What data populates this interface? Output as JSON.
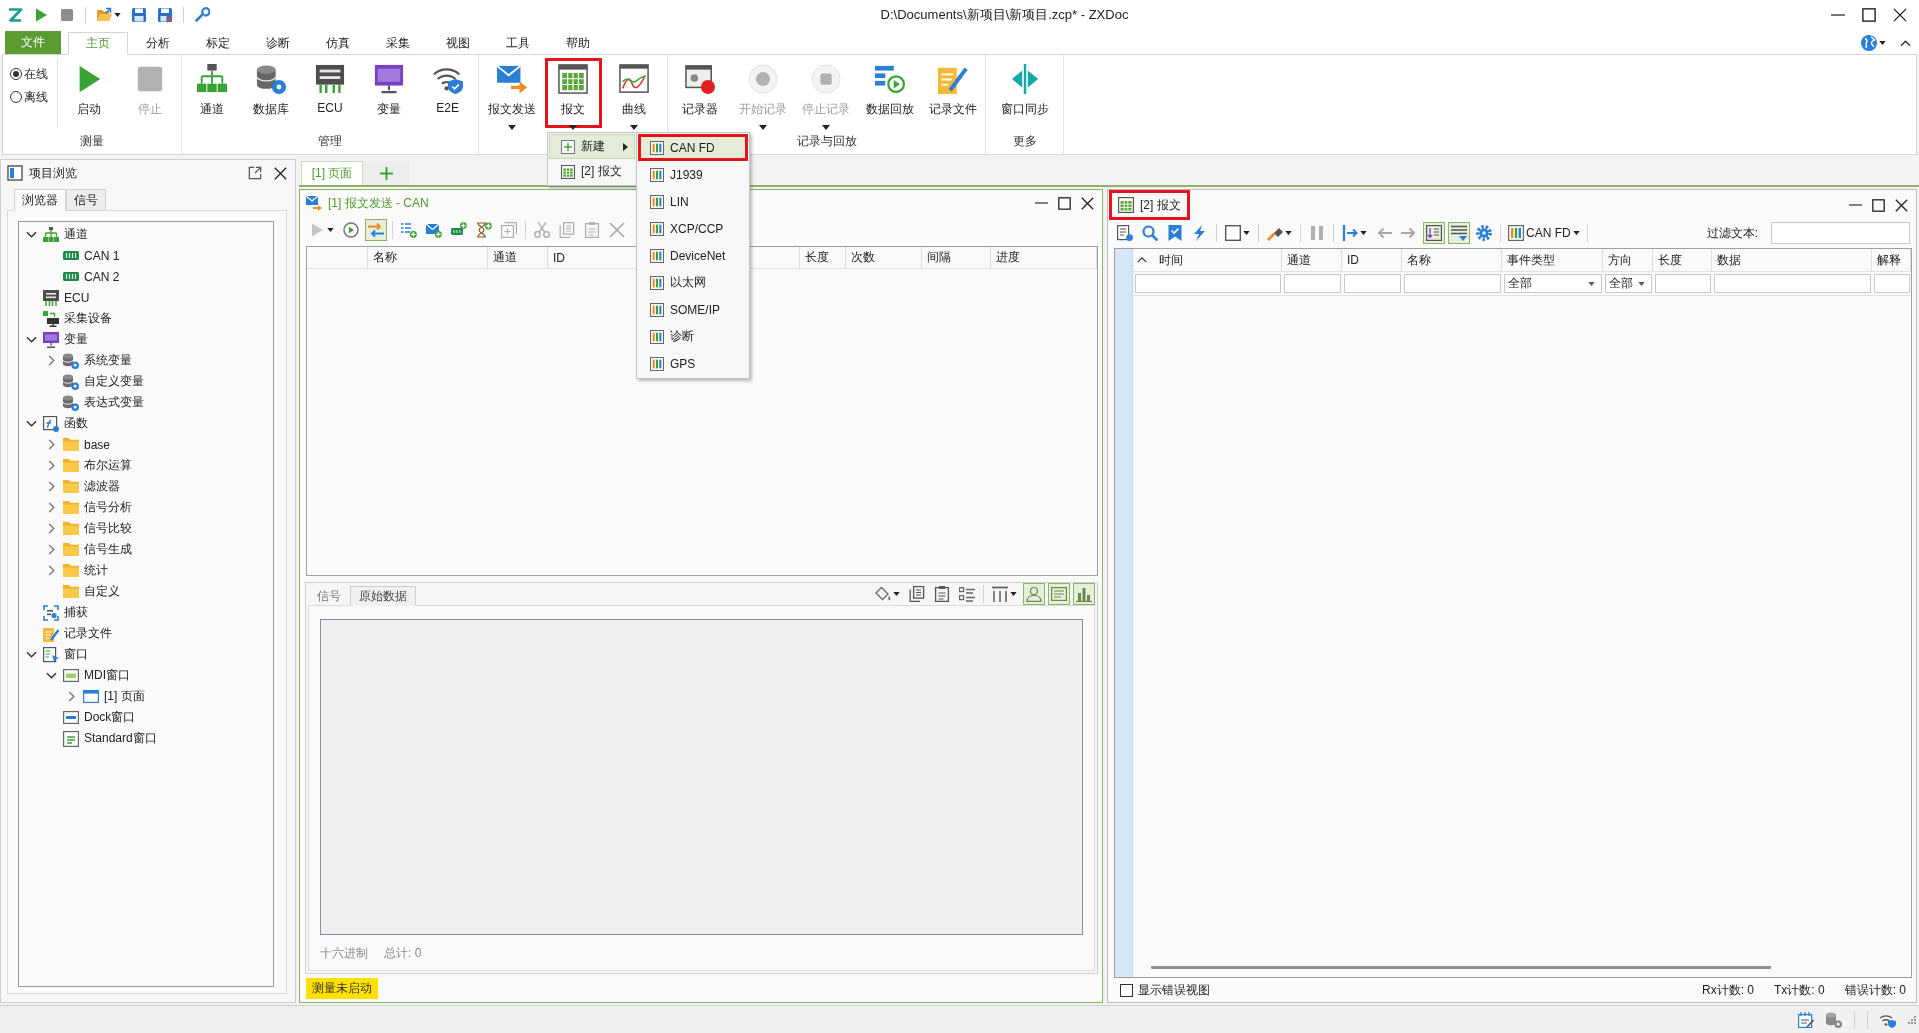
{
  "window": {
    "title": "D:\\Documents\\新项目\\新项目.zcp* - ZXDoc"
  },
  "ribbon": {
    "file_tab": "文件",
    "tabs": [
      {
        "label": "主页",
        "selected": true
      },
      {
        "label": "分析",
        "selected": false
      },
      {
        "label": "标定",
        "selected": false
      },
      {
        "label": "诊断",
        "selected": false
      },
      {
        "label": "仿真",
        "selected": false
      },
      {
        "label": "采集",
        "selected": false
      },
      {
        "label": "视图",
        "selected": false
      },
      {
        "label": "工具",
        "selected": false
      },
      {
        "label": "帮助",
        "selected": false
      }
    ],
    "mode_options": [
      {
        "label": "在线",
        "selected": true
      },
      {
        "label": "离线",
        "selected": false
      }
    ],
    "groups": [
      {
        "label": "测量",
        "buttons": [
          {
            "label": "启动",
            "disabled": false,
            "dropdown": false,
            "highlighted": false
          },
          {
            "label": "停止",
            "disabled": true,
            "dropdown": false,
            "highlighted": false
          }
        ]
      },
      {
        "label": "管理",
        "buttons": [
          {
            "label": "通道",
            "disabled": false,
            "dropdown": false,
            "highlighted": false
          },
          {
            "label": "数据库",
            "disabled": false,
            "dropdown": false,
            "highlighted": false
          },
          {
            "label": "ECU",
            "disabled": false,
            "dropdown": false,
            "highlighted": false
          },
          {
            "label": "变量",
            "disabled": false,
            "dropdown": false,
            "highlighted": false
          },
          {
            "label": "E2E",
            "disabled": false,
            "dropdown": false,
            "highlighted": false
          }
        ]
      },
      {
        "buttons": [
          {
            "label": "报文发送",
            "disabled": false,
            "dropdown": true,
            "highlighted": false
          },
          {
            "label": "报文",
            "disabled": false,
            "dropdown": true,
            "highlighted": true
          },
          {
            "label": "曲线",
            "disabled": false,
            "dropdown": true,
            "highlighted": false
          }
        ]
      },
      {
        "label": "记录与回放",
        "buttons": [
          {
            "label": "记录器",
            "disabled": false,
            "dropdown": false,
            "highlighted": false
          },
          {
            "label": "开始记录",
            "disabled": true,
            "dropdown": true,
            "highlighted": false
          },
          {
            "label": "停止记录",
            "disabled": true,
            "dropdown": true,
            "highlighted": false
          },
          {
            "label": "数据回放",
            "disabled": false,
            "dropdown": false,
            "highlighted": false
          },
          {
            "label": "记录文件",
            "disabled": false,
            "dropdown": false,
            "highlighted": false
          }
        ]
      },
      {
        "label": "更多",
        "buttons": [
          {
            "label": "窗口同步",
            "disabled": false,
            "dropdown": false,
            "highlighted": false
          }
        ]
      }
    ]
  },
  "dropdown_menu": {
    "items": [
      {
        "label": "新建",
        "selected": true,
        "submenu": true
      },
      {
        "label": "[2] 报文",
        "selected": false,
        "submenu": false
      }
    ],
    "submenu": [
      {
        "label": "CAN FD",
        "selected": true,
        "highlighted": true
      },
      {
        "label": "J1939",
        "selected": false,
        "highlighted": false
      },
      {
        "label": "LIN",
        "selected": false,
        "highlighted": false
      },
      {
        "label": "XCP/CCP",
        "selected": false,
        "highlighted": false
      },
      {
        "label": "DeviceNet",
        "selected": false,
        "highlighted": false
      },
      {
        "label": "以太网",
        "selected": false,
        "highlighted": false
      },
      {
        "label": "SOME/IP",
        "selected": false,
        "highlighted": false
      },
      {
        "label": "诊断",
        "selected": false,
        "highlighted": false
      },
      {
        "label": "GPS",
        "selected": false,
        "highlighted": false
      }
    ]
  },
  "project_browser": {
    "title": "项目浏览",
    "tabs": [
      {
        "label": "浏览器",
        "selected": true
      },
      {
        "label": "信号",
        "selected": false
      }
    ],
    "tree": [
      {
        "label": "通道",
        "expanded": true,
        "children": [
          {
            "label": "CAN 1"
          },
          {
            "label": "CAN 2"
          }
        ]
      },
      {
        "label": "ECU"
      },
      {
        "label": "采集设备"
      },
      {
        "label": "变量",
        "expanded": true,
        "children": [
          {
            "label": "系统变量",
            "expanded": false
          },
          {
            "label": "自定义变量"
          },
          {
            "label": "表达式变量"
          }
        ]
      },
      {
        "label": "函数",
        "expanded": true,
        "children": [
          {
            "label": "base",
            "expanded": false
          },
          {
            "label": "布尔运算",
            "expanded": false
          },
          {
            "label": "滤波器",
            "expanded": false
          },
          {
            "label": "信号分析",
            "expanded": false
          },
          {
            "label": "信号比较",
            "expanded": false
          },
          {
            "label": "信号生成",
            "expanded": false
          },
          {
            "label": "统计",
            "expanded": false
          },
          {
            "label": "自定义"
          }
        ]
      },
      {
        "label": "捕获"
      },
      {
        "label": "记录文件"
      },
      {
        "label": "窗口",
        "expanded": true,
        "children": [
          {
            "label": "MDI窗口",
            "expanded": true,
            "children": [
              {
                "label": "[1] 页面",
                "expanded": false
              }
            ]
          },
          {
            "label": "Dock窗口"
          },
          {
            "label": "Standard窗口"
          }
        ]
      }
    ]
  },
  "document_tabs": [
    {
      "label": "[1] 页面",
      "selected": true
    }
  ],
  "send_window": {
    "title": "[1] 报文发送 - CAN",
    "active": true,
    "toolbar": [
      {
        "pressed": false,
        "disabled": true,
        "dropdown": true
      },
      {
        "pressed": false,
        "disabled": false,
        "dropdown": false
      },
      {
        "pressed": true,
        "disabled": false,
        "dropdown": false
      },
      {
        "pressed": false,
        "disabled": false,
        "dropdown": false
      },
      {
        "pressed": false,
        "disabled": false,
        "dropdown": false
      },
      {
        "pressed": false,
        "disabled": false,
        "dropdown": false
      },
      {
        "pressed": false,
        "disabled": false,
        "dropdown": false
      },
      {
        "pressed": false,
        "disabled": true,
        "dropdown": false
      },
      {
        "pressed": false,
        "disabled": true,
        "dropdown": false
      },
      {
        "pressed": false,
        "disabled": true,
        "dropdown": false
      },
      {
        "pressed": false,
        "disabled": true,
        "dropdown": false
      },
      {
        "pressed": false,
        "disabled": true,
        "dropdown": false
      }
    ],
    "columns": [
      "名称",
      "通道",
      "ID",
      "长度",
      "次数",
      "间隔",
      "进度"
    ],
    "detail_tabs": [
      {
        "label": "信号",
        "selected": false
      },
      {
        "label": "原始数据",
        "selected": true
      }
    ],
    "detail_toolbar": [
      {
        "pressed": false,
        "disabled": false,
        "dropdown": true
      },
      {
        "pressed": false,
        "disabled": false,
        "dropdown": false
      },
      {
        "pressed": false,
        "disabled": false,
        "dropdown": false
      },
      {
        "pressed": false,
        "disabled": false,
        "dropdown": false
      },
      {
        "pressed": false,
        "disabled": false,
        "dropdown": true
      },
      {
        "pressed": true,
        "disabled": false,
        "dropdown": false
      },
      {
        "pressed": true,
        "disabled": false,
        "dropdown": false
      },
      {
        "pressed": true,
        "disabled": false,
        "dropdown": false
      }
    ],
    "detail_footer": [
      "十六进制",
      "总计: 0"
    ],
    "status": "测量未启动"
  },
  "message_window": {
    "title": "[2] 报文",
    "active": false,
    "highlighted": true,
    "toolbar": [
      {
        "pressed": false,
        "disabled": false,
        "dropdown": false
      },
      {
        "pressed": false,
        "disabled": false,
        "dropdown": false
      },
      {
        "pressed": false,
        "disabled": false,
        "dropdown": false
      },
      {
        "pressed": false,
        "disabled": false,
        "dropdown": false
      },
      {
        "pressed": false,
        "disabled": false,
        "dropdown": true
      },
      {
        "pressed": false,
        "disabled": false,
        "dropdown": true
      },
      {
        "pressed": false,
        "disabled": true,
        "dropdown": false
      },
      {
        "pressed": false,
        "disabled": false,
        "dropdown": true
      },
      {
        "pressed": false,
        "disabled": true,
        "dropdown": false
      },
      {
        "pressed": false,
        "disabled": true,
        "dropdown": false
      },
      {
        "pressed": true,
        "disabled": false,
        "dropdown": false
      },
      {
        "pressed": true,
        "disabled": false,
        "dropdown": false
      },
      {
        "pressed": false,
        "disabled": false,
        "dropdown": false
      }
    ],
    "protocol": "CAN FD",
    "filter_label": "过滤文本:",
    "columns": [
      "时间",
      "通道",
      "ID",
      "名称",
      "事件类型",
      "方向",
      "长度",
      "数据",
      "解释"
    ],
    "filter_row": [
      {
        "kind": "text"
      },
      {
        "kind": "text"
      },
      {
        "kind": "text"
      },
      {
        "kind": "text"
      },
      {
        "kind": "select",
        "value": "全部"
      },
      {
        "kind": "select",
        "value": "全部"
      },
      {
        "kind": "text"
      },
      {
        "kind": "text"
      },
      {
        "kind": "text"
      }
    ],
    "show_errors": {
      "label": "显示错误视图",
      "checked": false
    },
    "counters": [
      "Rx计数: 0",
      "Tx计数: 0",
      "错误计数: 0"
    ]
  }
}
